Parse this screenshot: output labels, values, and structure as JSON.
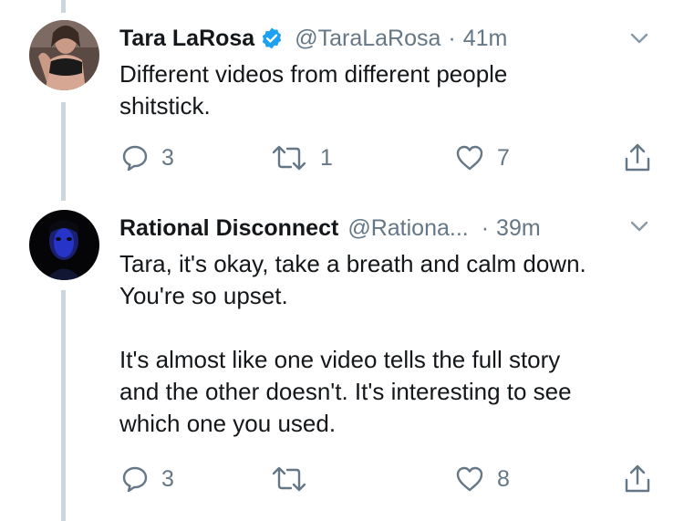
{
  "tweets": [
    {
      "author_name": "Tara LaRosa",
      "verified": true,
      "handle": "@TaraLaRosa",
      "separator": "·",
      "time": "41m",
      "text_lines": [
        "Different videos from different people",
        "shitstick."
      ],
      "reply_count": "3",
      "retweet_count": "1",
      "like_count": "7"
    },
    {
      "author_name": "Rational Disconnect",
      "verified": false,
      "handle": "@Rationa...",
      "separator": "·",
      "time": "39m",
      "paragraph1_lines": [
        "Tara, it's okay, take a breath and calm down.",
        "You're so upset."
      ],
      "paragraph2_lines": [
        "It's almost like one video tells the full story",
        "and the other doesn't. It's interesting to see",
        "which one you used."
      ],
      "reply_count": "3",
      "retweet_count": "",
      "like_count": "8"
    }
  ],
  "icons": {
    "reply": "reply-icon",
    "retweet": "retweet-icon",
    "like": "heart-icon",
    "share": "share-icon",
    "caret": "chevron-down-icon",
    "verified": "verified-badge-icon"
  },
  "colors": {
    "text": "#14171a",
    "secondary": "#657786",
    "verified_blue": "#1da1f2",
    "thread_line": "#ccd6dd"
  }
}
